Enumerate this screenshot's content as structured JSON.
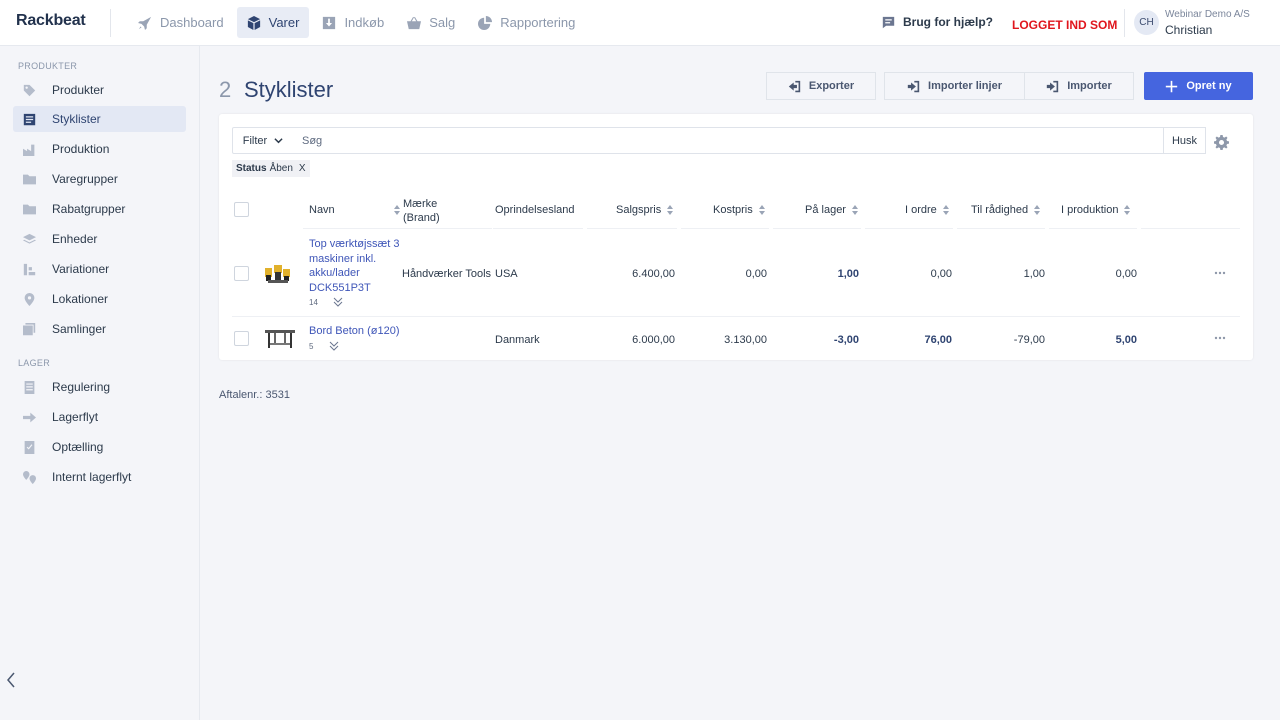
{
  "app": {
    "logo": "Rackbeat",
    "nav": [
      {
        "label": "Dashboard",
        "icon": "rocket-icon"
      },
      {
        "label": "Varer",
        "icon": "box-icon"
      },
      {
        "label": "Indkøb",
        "icon": "download-icon"
      },
      {
        "label": "Salg",
        "icon": "basket-icon"
      },
      {
        "label": "Rapportering",
        "icon": "pie-chart-icon"
      }
    ],
    "help_label": "Brug for hjælp?",
    "logged_in_as": "LOGGET IND SOM",
    "user": {
      "initials": "CH",
      "company": "Webinar Demo A/S",
      "name": "Christian"
    },
    "colors": {
      "primary": "#4565df",
      "danger": "#e0161d",
      "nav_active": "#2f4471"
    }
  },
  "sidebar": {
    "section_products": "PRODUKTER",
    "products_items": [
      {
        "label": "Produkter",
        "icon": "tag-icon"
      },
      {
        "label": "Styklister",
        "icon": "list-icon"
      },
      {
        "label": "Produktion",
        "icon": "factory-icon"
      },
      {
        "label": "Varegrupper",
        "icon": "folder-icon"
      },
      {
        "label": "Rabatgrupper",
        "icon": "folder-icon"
      },
      {
        "label": "Enheder",
        "icon": "layers-icon"
      },
      {
        "label": "Variationer",
        "icon": "variations-icon"
      },
      {
        "label": "Lokationer",
        "icon": "location-pin-icon"
      },
      {
        "label": "Samlinger",
        "icon": "collection-icon"
      }
    ],
    "section_stock": "LAGER",
    "stock_items": [
      {
        "label": "Regulering",
        "icon": "document-icon"
      },
      {
        "label": "Lagerflyt",
        "icon": "arrow-right-icon"
      },
      {
        "label": "Optælling",
        "icon": "checklist-icon"
      },
      {
        "label": "Internt lagerflyt",
        "icon": "pins-icon"
      }
    ]
  },
  "main": {
    "count": "2",
    "title": "Styklister",
    "buttons": {
      "export": "Exporter",
      "import_lines": "Importer linjer",
      "import": "Importer",
      "create": "Opret ny"
    },
    "filter_label": "Filter",
    "search_placeholder": "Søg",
    "husk_label": "Husk",
    "chip": {
      "key": "Status",
      "value": "Åben",
      "remove": "X"
    },
    "columns": {
      "name": "Navn",
      "brand_line1": "Mærke",
      "brand_line2": "(Brand)",
      "origin": "Oprindelsesland",
      "sale_price": "Salgspris",
      "cost_price": "Kostpris",
      "in_stock": "På lager",
      "on_order": "I ordre",
      "available": "Til rådighed",
      "in_production": "I produktion"
    },
    "rows": [
      {
        "name_lines": [
          "Top værktøjssæt 3",
          "maskiner inkl.",
          "akku/lader",
          "DCK551P3T"
        ],
        "sub": "14",
        "brand": "Håndværker Tools",
        "origin": "USA",
        "sale_price": "6.400,00",
        "cost_price": "0,00",
        "in_stock": "1,00",
        "on_order": "0,00",
        "available": "1,00",
        "in_production": "0,00"
      },
      {
        "name_lines": [
          "Bord Beton (ø120)"
        ],
        "sub": "5",
        "brand": "",
        "origin": "Danmark",
        "sale_price": "6.000,00",
        "cost_price": "3.130,00",
        "in_stock": "-3,00",
        "on_order": "76,00",
        "available": "-79,00",
        "in_production": "5,00"
      }
    ],
    "agreement": "Aftalenr.: 3531"
  }
}
